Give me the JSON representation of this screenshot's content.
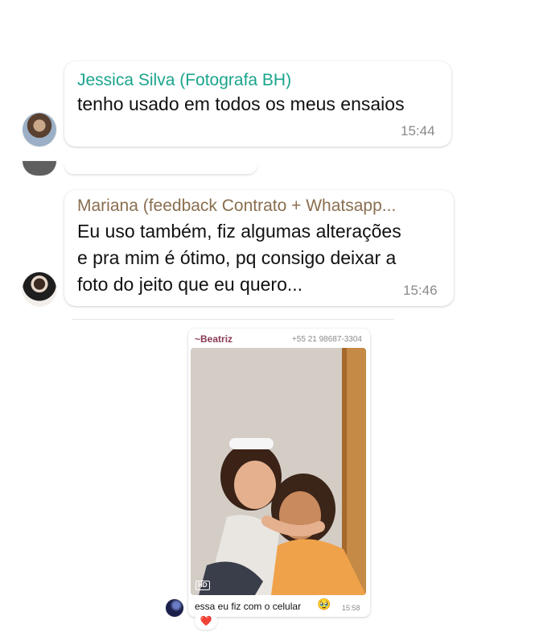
{
  "messages": [
    {
      "sender": "Jessica Silva (Fotografa BH)",
      "sender_color": "#1aa48c",
      "lines": [
        "tenho usado em todos os meus ensaios"
      ],
      "time": "15:44"
    },
    {
      "sender": "Mariana (feedback Contrato + Whatsapp...",
      "sender_color": "#8a6e4f",
      "lines": [
        "Eu uso também, fiz algumas alterações",
        "e pra mim é ótimo, pq consigo deixar a",
        "foto do jeito que eu quero..."
      ],
      "time": "15:46"
    }
  ],
  "photo_message": {
    "sender": "~Beatriz",
    "sender_color": "#8a3a55",
    "phone": "+55 21 98687-3304",
    "hd_badge": "HD",
    "caption": "essa eu fiz com o celular",
    "emoji": "🥹",
    "time": "15:58",
    "reaction": "❤️"
  }
}
